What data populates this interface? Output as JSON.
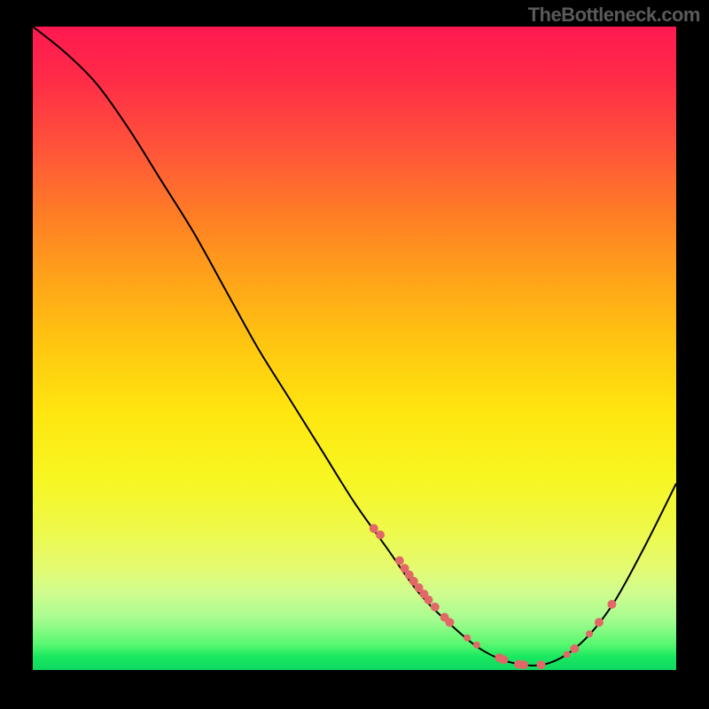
{
  "watermark": "TheBottleneck.com",
  "chart_data": {
    "type": "line",
    "title": "",
    "xlabel": "",
    "ylabel": "",
    "xlim": [
      0,
      100
    ],
    "ylim": [
      0,
      100
    ],
    "curve": [
      {
        "x": 0,
        "y": 100
      },
      {
        "x": 5,
        "y": 96
      },
      {
        "x": 10,
        "y": 91
      },
      {
        "x": 15,
        "y": 84
      },
      {
        "x": 20,
        "y": 76
      },
      {
        "x": 25,
        "y": 68
      },
      {
        "x": 30,
        "y": 59
      },
      {
        "x": 35,
        "y": 50
      },
      {
        "x": 40,
        "y": 42
      },
      {
        "x": 45,
        "y": 34
      },
      {
        "x": 50,
        "y": 26
      },
      {
        "x": 55,
        "y": 19
      },
      {
        "x": 60,
        "y": 12
      },
      {
        "x": 65,
        "y": 7
      },
      {
        "x": 70,
        "y": 3
      },
      {
        "x": 75,
        "y": 1
      },
      {
        "x": 80,
        "y": 1
      },
      {
        "x": 85,
        "y": 4
      },
      {
        "x": 90,
        "y": 10
      },
      {
        "x": 95,
        "y": 19
      },
      {
        "x": 100,
        "y": 29
      }
    ],
    "markers": [
      {
        "x": 53,
        "y": 22,
        "r": 5
      },
      {
        "x": 54,
        "y": 21,
        "r": 5
      },
      {
        "x": 57,
        "y": 17,
        "r": 5
      },
      {
        "x": 57.8,
        "y": 15.8,
        "r": 5
      },
      {
        "x": 58.5,
        "y": 14.8,
        "r": 5
      },
      {
        "x": 59.2,
        "y": 13.8,
        "r": 5
      },
      {
        "x": 60,
        "y": 12.8,
        "r": 5
      },
      {
        "x": 60.8,
        "y": 11.8,
        "r": 5
      },
      {
        "x": 61.5,
        "y": 10.9,
        "r": 5
      },
      {
        "x": 62.5,
        "y": 9.8,
        "r": 5
      },
      {
        "x": 64,
        "y": 8.2,
        "r": 5
      },
      {
        "x": 64.8,
        "y": 7.4,
        "r": 5
      },
      {
        "x": 67.5,
        "y": 5,
        "r": 4
      },
      {
        "x": 69,
        "y": 3.9,
        "r": 4
      },
      {
        "x": 72.5,
        "y": 1.9,
        "r": 5
      },
      {
        "x": 73.2,
        "y": 1.6,
        "r": 5
      },
      {
        "x": 75.5,
        "y": 0.9,
        "r": 5
      },
      {
        "x": 76.3,
        "y": 0.8,
        "r": 5
      },
      {
        "x": 79,
        "y": 0.8,
        "r": 5
      },
      {
        "x": 83,
        "y": 2.4,
        "r": 4
      },
      {
        "x": 84.2,
        "y": 3.3,
        "r": 5
      },
      {
        "x": 86.5,
        "y": 5.6,
        "r": 4
      },
      {
        "x": 88,
        "y": 7.4,
        "r": 5
      },
      {
        "x": 90,
        "y": 10.2,
        "r": 5
      }
    ]
  }
}
